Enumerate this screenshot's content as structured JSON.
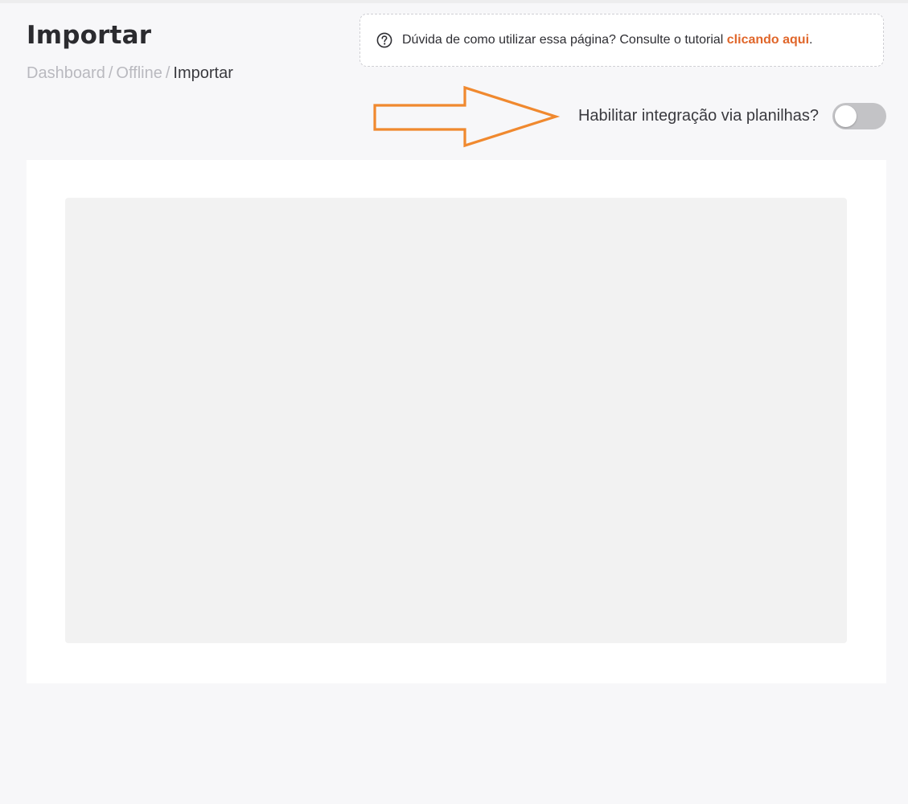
{
  "header": {
    "title": "Importar"
  },
  "breadcrumb": {
    "items": [
      "Dashboard",
      "Offline",
      "Importar"
    ],
    "separator": "/"
  },
  "help": {
    "icon": "question-circle-icon",
    "text": "Dúvida de como utilizar essa página? Consulte o tutorial ",
    "link_label": "clicando aqui",
    "suffix": "."
  },
  "integration_toggle": {
    "label": "Habilitar integração via planilhas?",
    "enabled": false
  },
  "colors": {
    "accent": "#e0662a",
    "annotation_arrow": "#f0892f",
    "toggle_off": "#c3c3c6",
    "background": "#f7f7f9"
  }
}
